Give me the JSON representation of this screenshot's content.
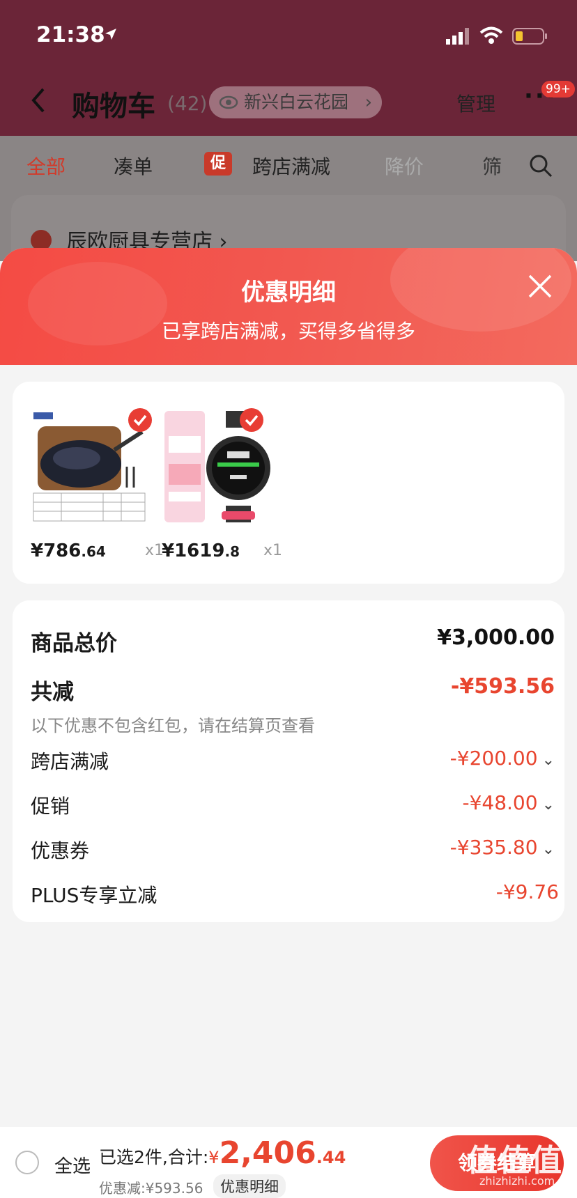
{
  "status": {
    "time": "21:38"
  },
  "nav": {
    "title": "购物车",
    "count": "(42)",
    "address": "新兴白云花园",
    "manage": "管理",
    "more": "···",
    "badge": "99+"
  },
  "filters": {
    "all": "全部",
    "cou": "凑单",
    "cu_tag": "促",
    "kua": "跨店满减",
    "jiang": "降价",
    "shai": "筛"
  },
  "store": {
    "name": "辰欧厨具专营店 ›"
  },
  "sheet": {
    "title": "优惠明细",
    "subtitle": "已享跨店满减，买得多省得多"
  },
  "products": [
    {
      "price_int": "¥786",
      "price_dec": ".64",
      "qty": "x1",
      "icon": "wok-product-image"
    },
    {
      "price_int": "¥1619",
      "price_dec": ".8",
      "qty": "x1",
      "icon": "smartwatch-product-image"
    }
  ],
  "details": {
    "total_label": "商品总价",
    "total_value": "¥3,000.00",
    "reduce_label": "共减",
    "reduce_value": "-¥593.56",
    "note": "以下优惠不包含红包，请在结算页查看",
    "rows": [
      {
        "label": "跨店满减",
        "value": "-¥200.00",
        "arrow": "⌄"
      },
      {
        "label": "促销",
        "value": "-¥48.00",
        "arrow": "⌄"
      },
      {
        "label": "优惠券",
        "value": "-¥335.80",
        "arrow": "⌄"
      },
      {
        "label": "PLUS专享立减",
        "value": "-¥9.76",
        "arrow": ""
      }
    ]
  },
  "bottom": {
    "select_all": "全选",
    "selected_text": "已选2件,合计:",
    "currency": "¥",
    "total_int": "2,406",
    "total_dec": ".44",
    "discount": "优惠减:¥593.56",
    "discount_detail": "优惠明细",
    "checkout": "领券结算"
  },
  "watermark": {
    "text": "值值值",
    "sub": "zhizhizhi.com"
  },
  "colors": {
    "accent": "#e8452f",
    "header": "#f44b44"
  }
}
